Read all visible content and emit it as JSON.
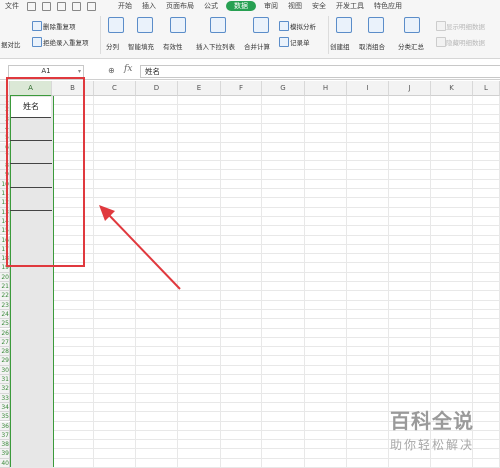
{
  "menu": {
    "items": [
      "文件",
      "开始",
      "插入",
      "页面布局",
      "公式",
      "数据",
      "审阅",
      "视图",
      "安全",
      "开发工具",
      "特色应用"
    ],
    "active_index": 5
  },
  "ribbon": {
    "compare_label": "据对比",
    "remove_dup_label": "删除重复项",
    "reject_dup_label": "拒绝录入重复项",
    "split_label": "分列",
    "smart_fill_label": "智能填充",
    "validity_label": "有效性",
    "dropdown_label": "插入下拉列表",
    "merge_calc_label": "合并计算",
    "simulate_label": "模拟分析",
    "record_label": "记录单",
    "create_group_label": "创建组",
    "ungroup_label": "取消组合",
    "subtotal_label": "分类汇总",
    "show_detail_label": "显示明细数据",
    "hide_detail_label": "隐藏明细数据"
  },
  "formula_bar": {
    "name_box": "A1",
    "fx_label": "fx",
    "content": "姓名"
  },
  "sheet": {
    "columns": [
      "A",
      "B",
      "C",
      "D",
      "E",
      "F",
      "G",
      "H",
      "I",
      "J",
      "K",
      "L"
    ],
    "rows": [
      "1",
      "2",
      "3",
      "4",
      "5",
      "6",
      "7",
      "8",
      "9",
      "10",
      "11",
      "12",
      "13",
      "14",
      "15",
      "16",
      "17",
      "18",
      "19",
      "20",
      "21",
      "22",
      "23",
      "24",
      "25",
      "26",
      "27",
      "28",
      "29",
      "30",
      "31",
      "32",
      "33",
      "34",
      "35",
      "36",
      "37",
      "38",
      "39",
      "40"
    ],
    "cell_a1": "姓名"
  },
  "watermark": {
    "title": "百科全说",
    "subtitle": "助你轻松解决"
  },
  "colors": {
    "accent": "#27a052",
    "selection": "#3b9a3b",
    "highlight_box": "#e0393e"
  }
}
